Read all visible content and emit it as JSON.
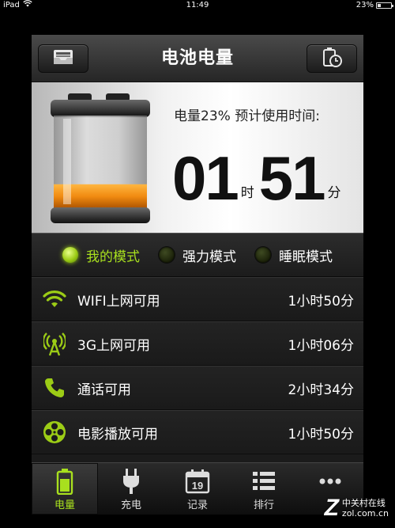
{
  "status_bar": {
    "device": "iPad",
    "time": "11:49",
    "battery_percent": "23%"
  },
  "header": {
    "title": "电池电量",
    "left_icon": "tray-icon",
    "right_icon": "battery-clock-icon"
  },
  "battery": {
    "estimate_label": "电量23%  预计使用时间:",
    "charge_level": 0.23,
    "hours": "01",
    "hours_unit": "时",
    "minutes": "51",
    "minutes_unit": "分"
  },
  "modes": [
    {
      "label": "我的模式",
      "active": true
    },
    {
      "label": "强力模式",
      "active": false
    },
    {
      "label": "睡眠模式",
      "active": false
    }
  ],
  "usage": [
    {
      "icon": "wifi-icon",
      "label": "WIFI上网可用",
      "value": "1小时50分"
    },
    {
      "icon": "cell-tower-icon",
      "label": "3G上网可用",
      "value": "1小时06分"
    },
    {
      "icon": "phone-icon",
      "label": "通话可用",
      "value": "2小时34分"
    },
    {
      "icon": "film-reel-icon",
      "label": "电影播放可用",
      "value": "1小时50分"
    }
  ],
  "tabs": [
    {
      "icon": "battery-icon",
      "label": "电量",
      "active": true
    },
    {
      "icon": "plug-icon",
      "label": "充电",
      "active": false
    },
    {
      "icon": "calendar-icon",
      "label": "记录",
      "active": false,
      "calendar_day": "19"
    },
    {
      "icon": "list-icon",
      "label": "排行",
      "active": false
    },
    {
      "icon": "more-icon",
      "label": "",
      "active": false
    }
  ],
  "watermark": {
    "logo": "Z",
    "line1": "中关村在线",
    "line2": "zol.com.cn"
  },
  "colors": {
    "accent_green": "#a8e01e",
    "battery_fill": "#f08a10"
  }
}
